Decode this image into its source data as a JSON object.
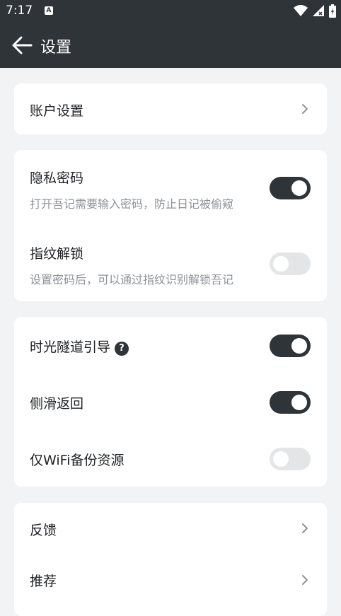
{
  "status_bar": {
    "time": "7:17",
    "notification_icon": "text-icon"
  },
  "app_bar": {
    "title": "设置",
    "back_icon": "arrow-left-icon"
  },
  "groups": [
    {
      "items": [
        {
          "label": "账户设置",
          "type": "link"
        }
      ]
    },
    {
      "items": [
        {
          "label": "隐私密码",
          "description": "打开吾记需要输入密码，防止日记被偷窥",
          "type": "toggle",
          "on": true
        },
        {
          "label": "指纹解锁",
          "description": "设置密码后，可以通过指纹识别解锁吾记",
          "type": "toggle",
          "on": false
        }
      ]
    },
    {
      "items": [
        {
          "label": "时光隧道引导",
          "type": "toggle",
          "on": true,
          "has_help": true
        },
        {
          "label": "侧滑返回",
          "type": "toggle",
          "on": true
        },
        {
          "label": "仅WiFi备份资源",
          "type": "toggle",
          "on": false
        }
      ]
    },
    {
      "items": [
        {
          "label": "反馈",
          "type": "link"
        },
        {
          "label": "推荐",
          "type": "link"
        }
      ]
    }
  ],
  "colors": {
    "dark": "#2f3439",
    "background": "#f2f3f5",
    "card": "#ffffff",
    "toggle_off": "#e4e5e7"
  }
}
